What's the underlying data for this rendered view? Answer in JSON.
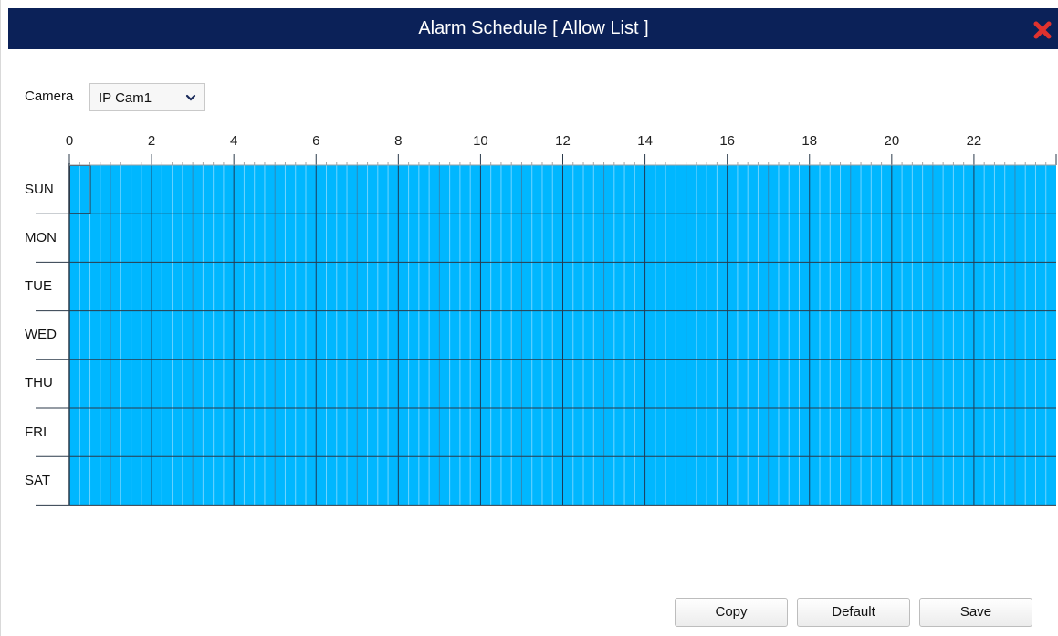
{
  "window": {
    "title": "Alarm Schedule [ Allow List ]",
    "close_icon": "close-icon"
  },
  "camera": {
    "label": "Camera",
    "selected": "IP Cam1"
  },
  "schedule": {
    "hour_labels": [
      "0",
      "2",
      "4",
      "6",
      "8",
      "10",
      "12",
      "14",
      "16",
      "18",
      "20",
      "22"
    ],
    "days": [
      "SUN",
      "MON",
      "TUE",
      "WED",
      "THU",
      "FRI",
      "SAT"
    ],
    "fill_color": "#00b7ff",
    "all_slots_active": true
  },
  "buttons": {
    "copy": "Copy",
    "default": "Default",
    "save": "Save"
  }
}
